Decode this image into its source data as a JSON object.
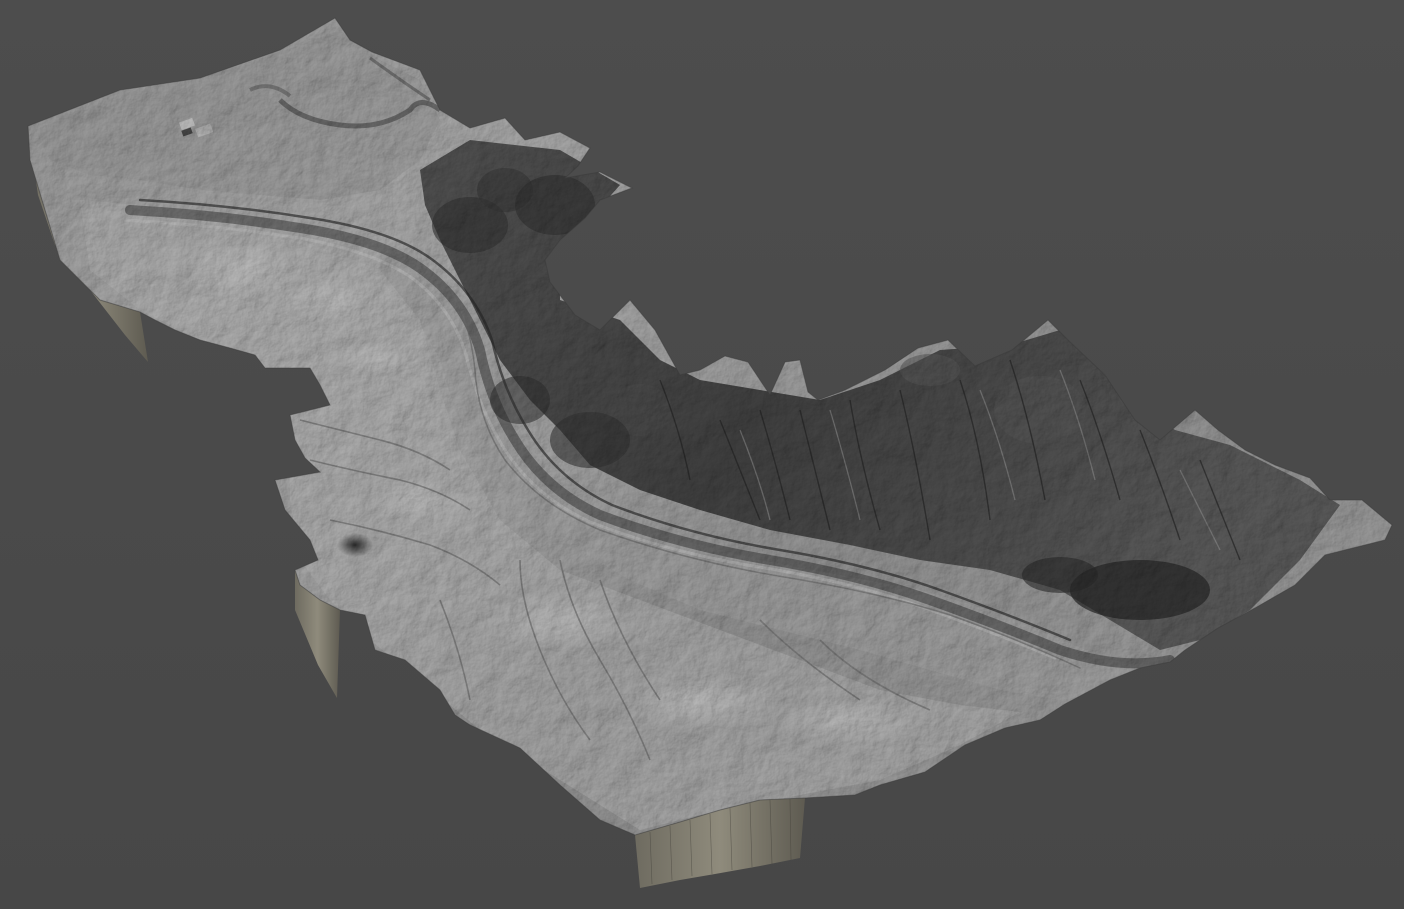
{
  "scene": {
    "subject": "terrain-relief-model",
    "render_style": "grayscale-hillshade",
    "colors": {
      "background": "#4a4a4a",
      "surface_light": "#dcdcdc",
      "surface_mid": "#a8a8a8",
      "surface_dark": "#3e3e3e",
      "side_wall": "#5c5a52"
    }
  }
}
